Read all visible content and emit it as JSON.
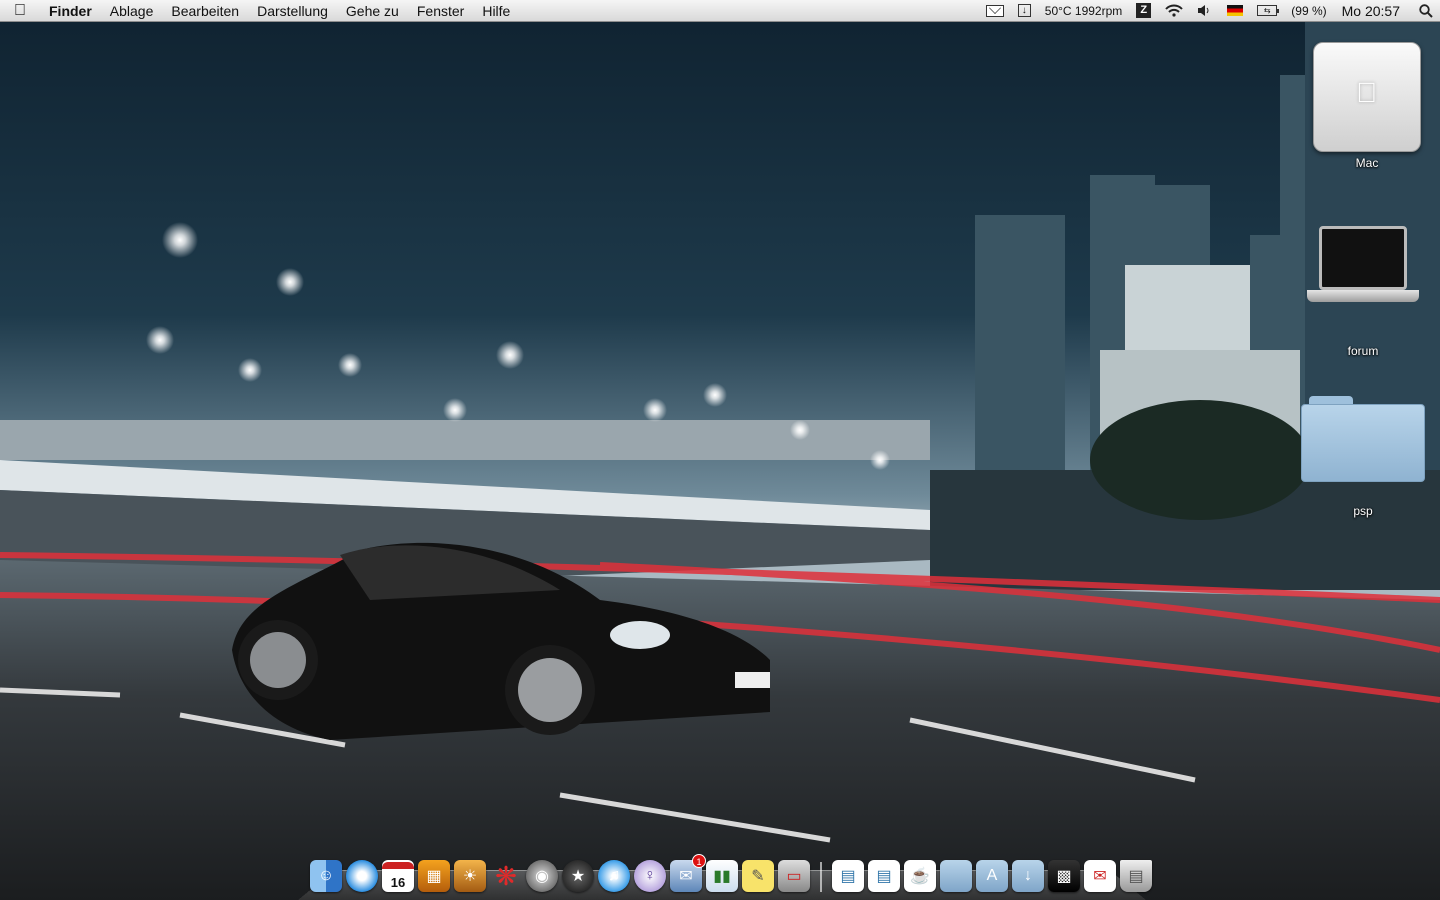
{
  "menubar": {
    "menus": [
      "Finder",
      "Ablage",
      "Bearbeiten",
      "Darstellung",
      "Gehe zu",
      "Fenster",
      "Hilfe"
    ],
    "status_temp": "50°C 1992rpm",
    "battery": "(99 %)",
    "clock": "Mo 20:57",
    "icons": [
      "apple-icon",
      "mail-icon",
      "download-icon",
      "z-icon",
      "wifi-icon",
      "volume-icon",
      "flag-de-icon",
      "battery-icon",
      "spotlight-icon"
    ]
  },
  "desktop": {
    "icons": [
      {
        "label": "Mac",
        "type": "hard-drive"
      },
      {
        "label": "forum",
        "type": "laptop"
      },
      {
        "label": "psp",
        "type": "folder"
      }
    ]
  },
  "dock": {
    "calendar_day": "16",
    "mail_badge": "1",
    "apps": [
      "finder",
      "safari",
      "ical",
      "dashboard",
      "iphoto",
      "crossover",
      "screenshot",
      "aperture",
      "itunes",
      "adium",
      "mail",
      "numbers",
      "stickies",
      "parallels"
    ],
    "docs": [
      "document",
      "document",
      "java",
      "folder",
      "applications",
      "downloads",
      "screenshots",
      "preview",
      "trash"
    ]
  },
  "colors": {
    "menubar": "#e6e6e6",
    "sky": "#1d3040",
    "road": "#2a2f33",
    "accent_red": "#e0303a"
  }
}
